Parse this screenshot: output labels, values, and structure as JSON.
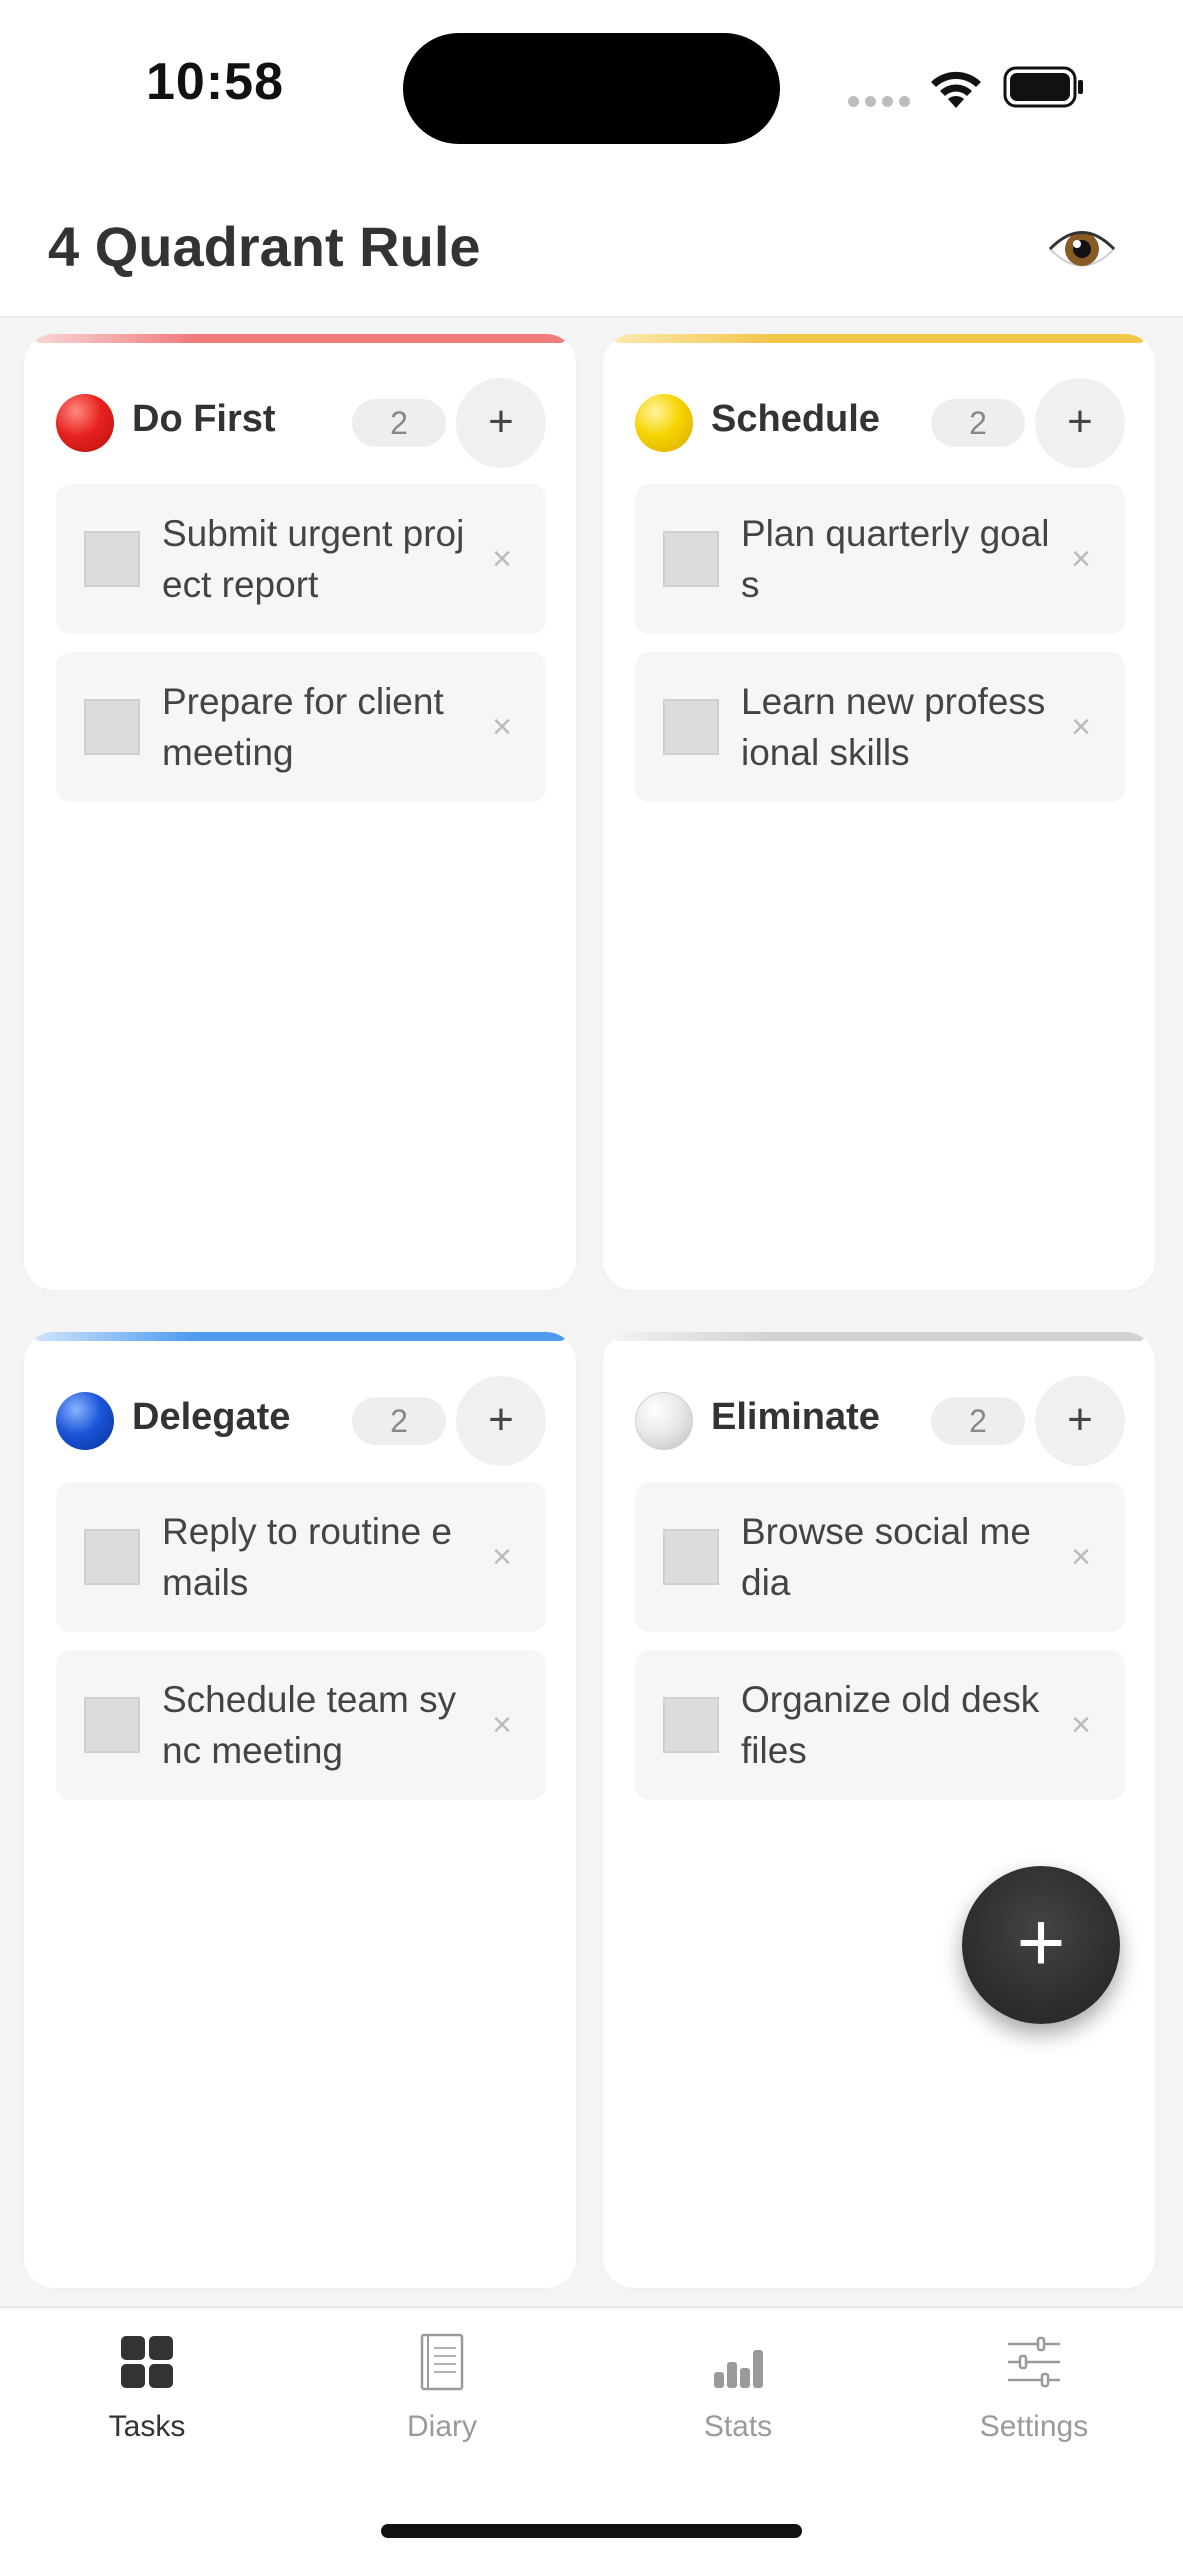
{
  "status_bar": {
    "time": "10:58"
  },
  "header": {
    "title": "4 Quadrant Rule",
    "eye_icon": "eye-icon"
  },
  "colors": {
    "do_first": "#e8221f",
    "schedule": "#f6c800",
    "delegate": "#1a55d8",
    "eliminate": "#d8d8d8",
    "fab": "#2f2f2f"
  },
  "quadrants": [
    {
      "title": "Do First",
      "count": "2",
      "add_label": "+",
      "tasks": [
        {
          "text": "Submit urgent project report",
          "delete_label": "×"
        },
        {
          "text": "Prepare for client meeting",
          "delete_label": "×"
        }
      ]
    },
    {
      "title": "Schedule",
      "count": "2",
      "add_label": "+",
      "tasks": [
        {
          "text": "Plan quarterly goals",
          "delete_label": "×"
        },
        {
          "text": "Learn new professional skills",
          "delete_label": "×"
        }
      ]
    },
    {
      "title": "Delegate",
      "count": "2",
      "add_label": "+",
      "tasks": [
        {
          "text": "Reply to routine emails",
          "delete_label": "×"
        },
        {
          "text": "Schedule team sync meeting",
          "delete_label": "×"
        }
      ]
    },
    {
      "title": "Eliminate",
      "count": "2",
      "add_label": "+",
      "tasks": [
        {
          "text": "Browse social media",
          "delete_label": "×"
        },
        {
          "text": "Organize old desk files",
          "delete_label": "×"
        }
      ]
    }
  ],
  "fab": {
    "label": "+"
  },
  "tab_bar": {
    "tabs": [
      {
        "label": "Tasks",
        "icon": "grid-icon"
      },
      {
        "label": "Diary",
        "icon": "notebook-icon"
      },
      {
        "label": "Stats",
        "icon": "bar-chart-icon"
      },
      {
        "label": "Settings",
        "icon": "sliders-icon"
      }
    ],
    "active": "Tasks"
  }
}
